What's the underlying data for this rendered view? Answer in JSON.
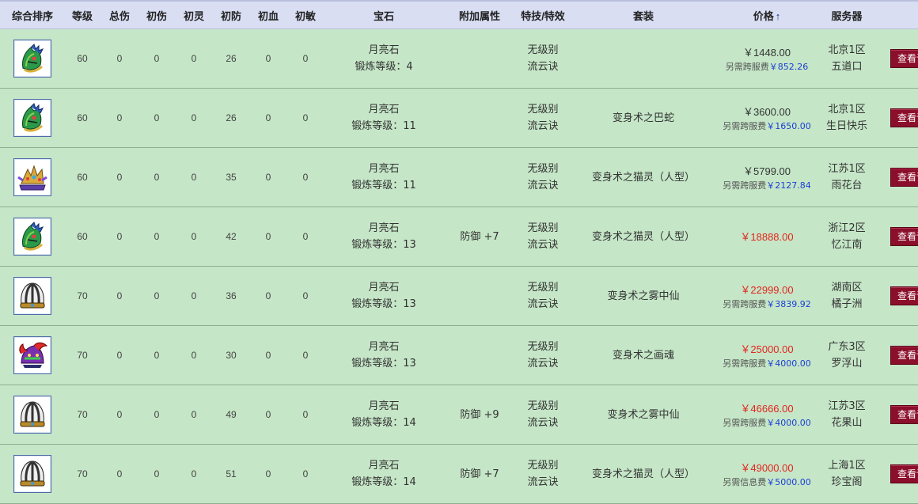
{
  "headers": [
    "综合排序",
    "等级",
    "总伤",
    "初伤",
    "初灵",
    "初防",
    "初血",
    "初敏",
    "宝石",
    "附加属性",
    "特技/特效",
    "套装",
    "价格",
    "服务器"
  ],
  "sort_arrow": "↑",
  "detail_label": "查看详情",
  "rows": [
    {
      "icon": "green-dragon-helmet-icon",
      "level": "60",
      "total": "0",
      "dmg": "0",
      "spirit": "0",
      "def": "26",
      "hp": "0",
      "spd": "0",
      "gem": "月亮石",
      "gem_level": "锻炼等级：4",
      "extra": "",
      "skill1": "无级别",
      "skill2": "流云诀",
      "set": "",
      "price": "￥1448.00",
      "price_color": "plain",
      "fee_label": "另需跨服费",
      "fee_amount": "￥852.26",
      "server1": "北京1区",
      "server2": "五道口"
    },
    {
      "icon": "green-dragon-helmet-icon",
      "level": "60",
      "total": "0",
      "dmg": "0",
      "spirit": "0",
      "def": "26",
      "hp": "0",
      "spd": "0",
      "gem": "月亮石",
      "gem_level": "锻炼等级：11",
      "extra": "",
      "skill1": "无级别",
      "skill2": "流云诀",
      "set": "变身术之巴蛇",
      "price": "￥3600.00",
      "price_color": "plain",
      "fee_label": "另需跨服费",
      "fee_amount": "￥1650.00",
      "server1": "北京1区",
      "server2": "生日快乐"
    },
    {
      "icon": "gold-phoenix-crown-icon",
      "level": "60",
      "total": "0",
      "dmg": "0",
      "spirit": "0",
      "def": "35",
      "hp": "0",
      "spd": "0",
      "gem": "月亮石",
      "gem_level": "锻炼等级：11",
      "extra": "",
      "skill1": "无级别",
      "skill2": "流云诀",
      "set": "变身术之猫灵（人型）",
      "price": "￥5799.00",
      "price_color": "plain",
      "fee_label": "另需跨服费",
      "fee_amount": "￥2127.84",
      "server1": "江苏1区",
      "server2": "雨花台"
    },
    {
      "icon": "green-dragon-helmet-icon",
      "level": "60",
      "total": "0",
      "dmg": "0",
      "spirit": "0",
      "def": "42",
      "hp": "0",
      "spd": "0",
      "gem": "月亮石",
      "gem_level": "锻炼等级：13",
      "extra": "防御 +7",
      "skill1": "无级别",
      "skill2": "流云诀",
      "set": "变身术之猫灵（人型）",
      "price": "￥18888.00",
      "price_color": "red",
      "fee_label": "",
      "fee_amount": "",
      "server1": "浙江2区",
      "server2": "忆江南"
    },
    {
      "icon": "striped-cap-icon",
      "level": "70",
      "total": "0",
      "dmg": "0",
      "spirit": "0",
      "def": "36",
      "hp": "0",
      "spd": "0",
      "gem": "月亮石",
      "gem_level": "锻炼等级：13",
      "extra": "",
      "skill1": "无级别",
      "skill2": "流云诀",
      "set": "变身术之雾中仙",
      "price": "￥22999.00",
      "price_color": "red",
      "fee_label": "另需跨服费",
      "fee_amount": "￥3839.92",
      "server1": "湖南区",
      "server2": "橘子洲"
    },
    {
      "icon": "red-demon-helmet-icon",
      "level": "70",
      "total": "0",
      "dmg": "0",
      "spirit": "0",
      "def": "30",
      "hp": "0",
      "spd": "0",
      "gem": "月亮石",
      "gem_level": "锻炼等级：13",
      "extra": "",
      "skill1": "无级别",
      "skill2": "流云诀",
      "set": "变身术之画魂",
      "price": "￥25000.00",
      "price_color": "red",
      "fee_label": "另需跨服费",
      "fee_amount": "￥4000.00",
      "server1": "广东3区",
      "server2": "罗浮山"
    },
    {
      "icon": "striped-cap-icon",
      "level": "70",
      "total": "0",
      "dmg": "0",
      "spirit": "0",
      "def": "49",
      "hp": "0",
      "spd": "0",
      "gem": "月亮石",
      "gem_level": "锻炼等级：14",
      "extra": "防御 +9",
      "skill1": "无级别",
      "skill2": "流云诀",
      "set": "变身术之雾中仙",
      "price": "￥46666.00",
      "price_color": "red",
      "fee_label": "另需跨服费",
      "fee_amount": "￥4000.00",
      "server1": "江苏3区",
      "server2": "花果山"
    },
    {
      "icon": "striped-cap-icon",
      "level": "70",
      "total": "0",
      "dmg": "0",
      "spirit": "0",
      "def": "51",
      "hp": "0",
      "spd": "0",
      "gem": "月亮石",
      "gem_level": "锻炼等级：14",
      "extra": "防御 +7",
      "skill1": "无级别",
      "skill2": "流云诀",
      "set": "变身术之猫灵（人型）",
      "price": "￥49000.00",
      "price_color": "red",
      "fee_label": "另需信息费",
      "fee_amount": "￥5000.00",
      "server1": "上海1区",
      "server2": "珍宝阁"
    }
  ]
}
